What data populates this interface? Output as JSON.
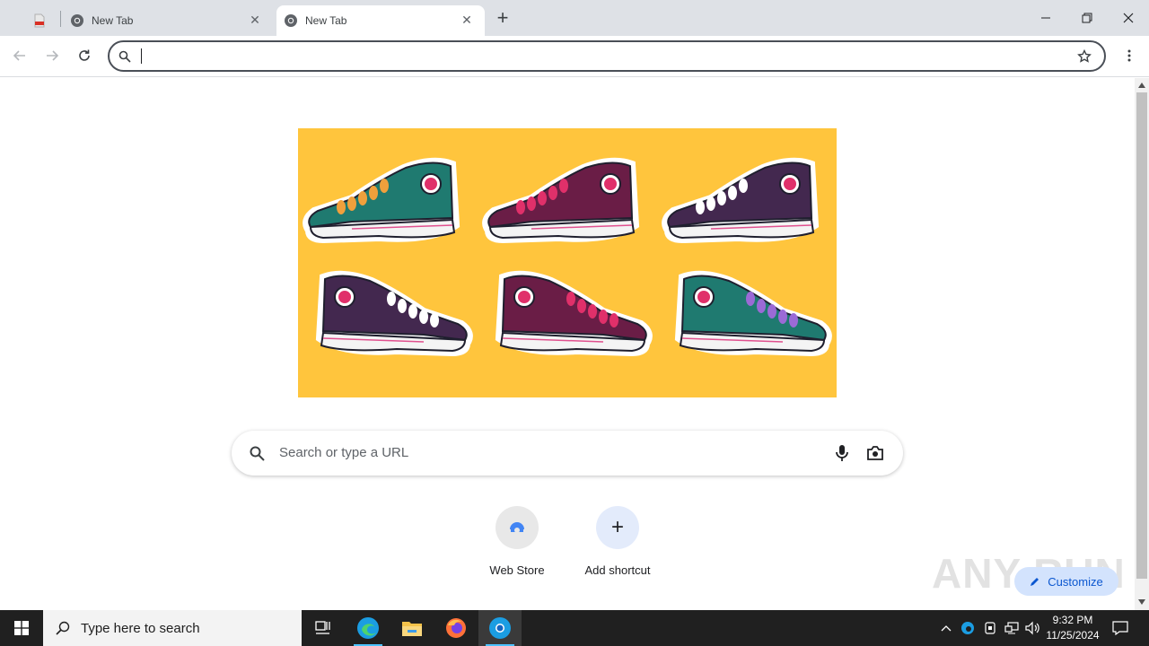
{
  "browser": {
    "tabs": [
      {
        "label": ""
      },
      {
        "label": "New Tab"
      },
      {
        "label": "New Tab"
      }
    ],
    "new_tab_symbol": "+",
    "omnibox": {
      "value": "",
      "placeholder": ""
    }
  },
  "ntp": {
    "search_placeholder": "Search or type a URL",
    "shortcuts": [
      {
        "label": "Web Store"
      },
      {
        "label": "Add shortcut"
      }
    ],
    "add_symbol": "+",
    "customize_label": "Customize",
    "watermark": "ANY RUN"
  },
  "taskbar": {
    "search_placeholder": "Type here to search",
    "time": "9:32 PM",
    "date": "11/25/2024"
  },
  "colors": {
    "doodle_bg": "#ffc53d",
    "taskbar_bg": "#202020",
    "tabstrip_bg": "#dee1e6",
    "accent": "#0b57d0"
  }
}
